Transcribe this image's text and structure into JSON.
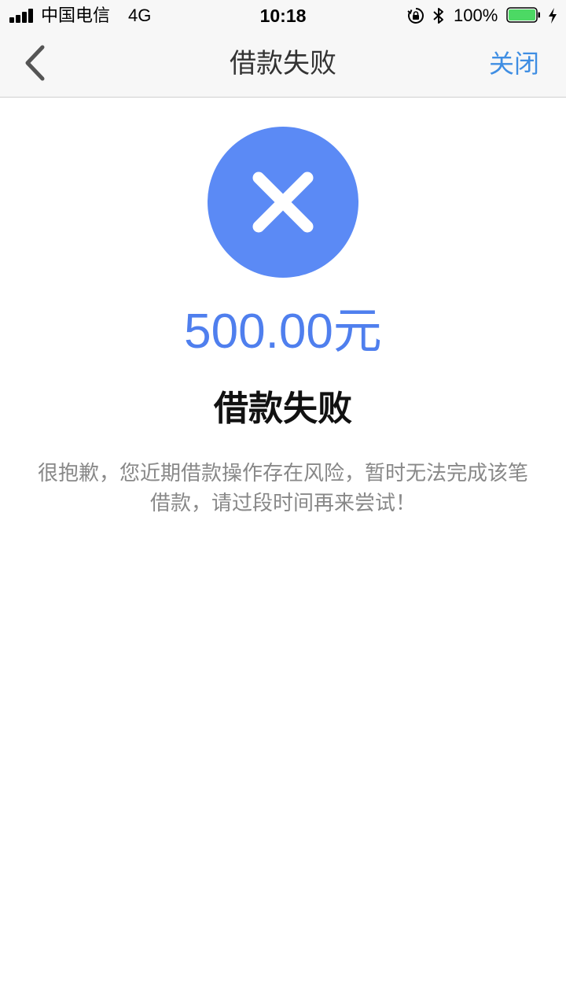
{
  "status_bar": {
    "carrier": "中国电信",
    "network": "4G",
    "time": "10:18",
    "battery_percent": "100%",
    "battery_level": 1.0,
    "signal_bars": 4,
    "icons": [
      "signal-icon",
      "orientation-lock-icon",
      "bluetooth-icon",
      "battery-icon",
      "charging-icon"
    ]
  },
  "nav": {
    "back_icon": "chevron-left-icon",
    "title": "借款失败",
    "close_label": "关闭"
  },
  "result": {
    "status_icon": "close-x-icon",
    "amount": "500.00元",
    "title": "借款失败",
    "message": "很抱歉，您近期借款操作存在风险，暂时无法完成该笔借款，请过段时间再来尝试！"
  },
  "colors": {
    "accent_circle": "#5b8af5",
    "amount_text": "#4f7fee",
    "link": "#3f8ee3",
    "battery_fill": "#4cd964"
  }
}
